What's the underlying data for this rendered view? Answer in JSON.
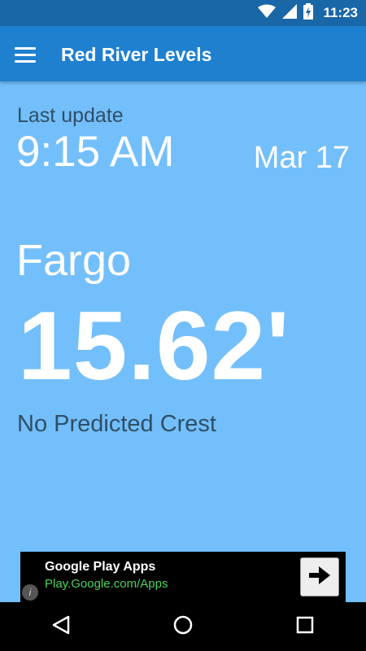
{
  "status_bar": {
    "time": "11:23",
    "icons": [
      "wifi-icon",
      "signal-icon",
      "battery-charging-icon"
    ]
  },
  "app_bar": {
    "title": "Red River Levels",
    "menu_icon": "hamburger-menu-icon"
  },
  "main": {
    "last_update_label": "Last update",
    "update_time": "9:15 AM",
    "update_date": "Mar 17",
    "city": "Fargo",
    "level": "15.62'",
    "crest_status": "No Predicted Crest"
  },
  "ad": {
    "title": "Google Play Apps",
    "url": "Play.Google.com/Apps",
    "info_glyph": "i",
    "action_icon": "arrow-right-icon"
  },
  "nav_bar": {
    "icons": [
      "back-icon",
      "home-icon",
      "recents-icon"
    ]
  },
  "colors": {
    "background": "#73bffb",
    "app_bar": "#1f80d0",
    "status_bar": "#1a67a8",
    "text_dark": "#2f4f66",
    "ad_url": "#4cd35c"
  }
}
